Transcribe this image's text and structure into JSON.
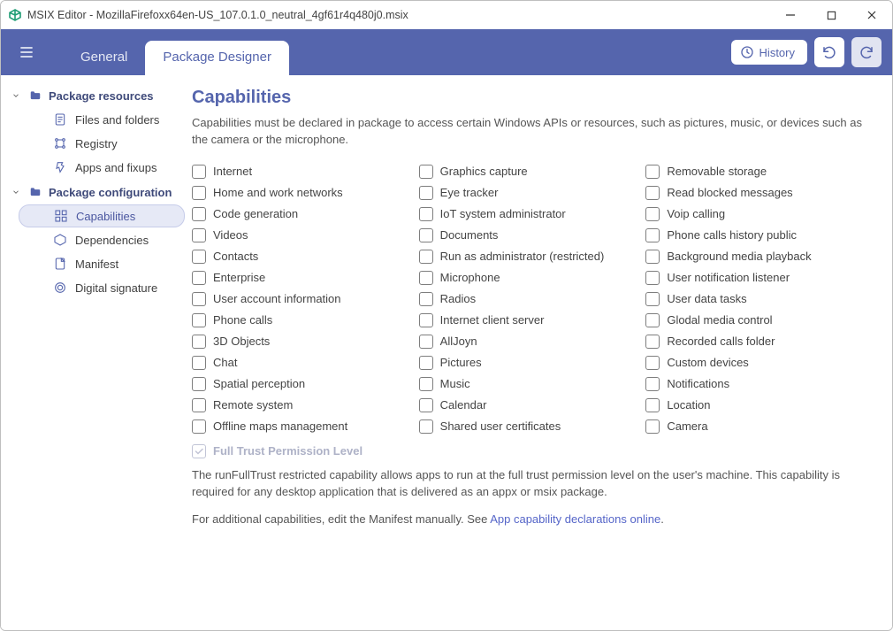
{
  "window": {
    "title": "MSIX Editor - MozillaFirefoxx64en-US_107.0.1.0_neutral_4gf61r4q480j0.msix"
  },
  "nav": {
    "tabs": [
      {
        "label": "General",
        "active": false
      },
      {
        "label": "Package Designer",
        "active": true
      }
    ],
    "history_label": "History"
  },
  "sidebar": {
    "groups": [
      {
        "label": "Package resources",
        "children": [
          {
            "label": "Files and folders"
          },
          {
            "label": "Registry"
          },
          {
            "label": "Apps and fixups"
          }
        ]
      },
      {
        "label": "Package configuration",
        "children": [
          {
            "label": "Capabilities",
            "selected": true
          },
          {
            "label": "Dependencies"
          },
          {
            "label": "Manifest"
          },
          {
            "label": "Digital signature"
          }
        ]
      }
    ]
  },
  "content": {
    "heading": "Capabilities",
    "intro": "Capabilities must be declared in package to access certain Windows APIs or resources, such as pictures, music, or devices such as the camera or the microphone.",
    "columns": [
      [
        "Internet",
        "Home and work networks",
        "Code generation",
        "Videos",
        "Contacts",
        "Enterprise",
        "User account information",
        "Phone calls",
        "3D Objects",
        "Chat",
        "Spatial perception",
        "Remote system",
        "Offline maps management"
      ],
      [
        "Graphics capture",
        "Eye tracker",
        "IoT system administrator",
        "Documents",
        "Run as administrator (restricted)",
        "Microphone",
        "Radios",
        "Internet client server",
        "AllJoyn",
        "Pictures",
        "Music",
        "Calendar",
        "Shared user certificates"
      ],
      [
        "Removable storage",
        "Read blocked messages",
        "Voip calling",
        "Phone calls history public",
        "Background media playback",
        "User notification listener",
        "User data tasks",
        "Glodal media control",
        "Recorded calls folder",
        "Custom devices",
        "Notifications",
        "Location",
        "Camera"
      ]
    ],
    "full_trust_label": "Full Trust Permission Level",
    "full_trust_desc": "The runFullTrust restricted capability allows apps to run at the full trust permission level on the user's machine. This capability is required for any desktop application that is delivered as an appx or msix package.",
    "link_prefix": "For additional capabilities, edit the Manifest manually. See ",
    "link_text": "App capability declarations online",
    "link_suffix": "."
  }
}
